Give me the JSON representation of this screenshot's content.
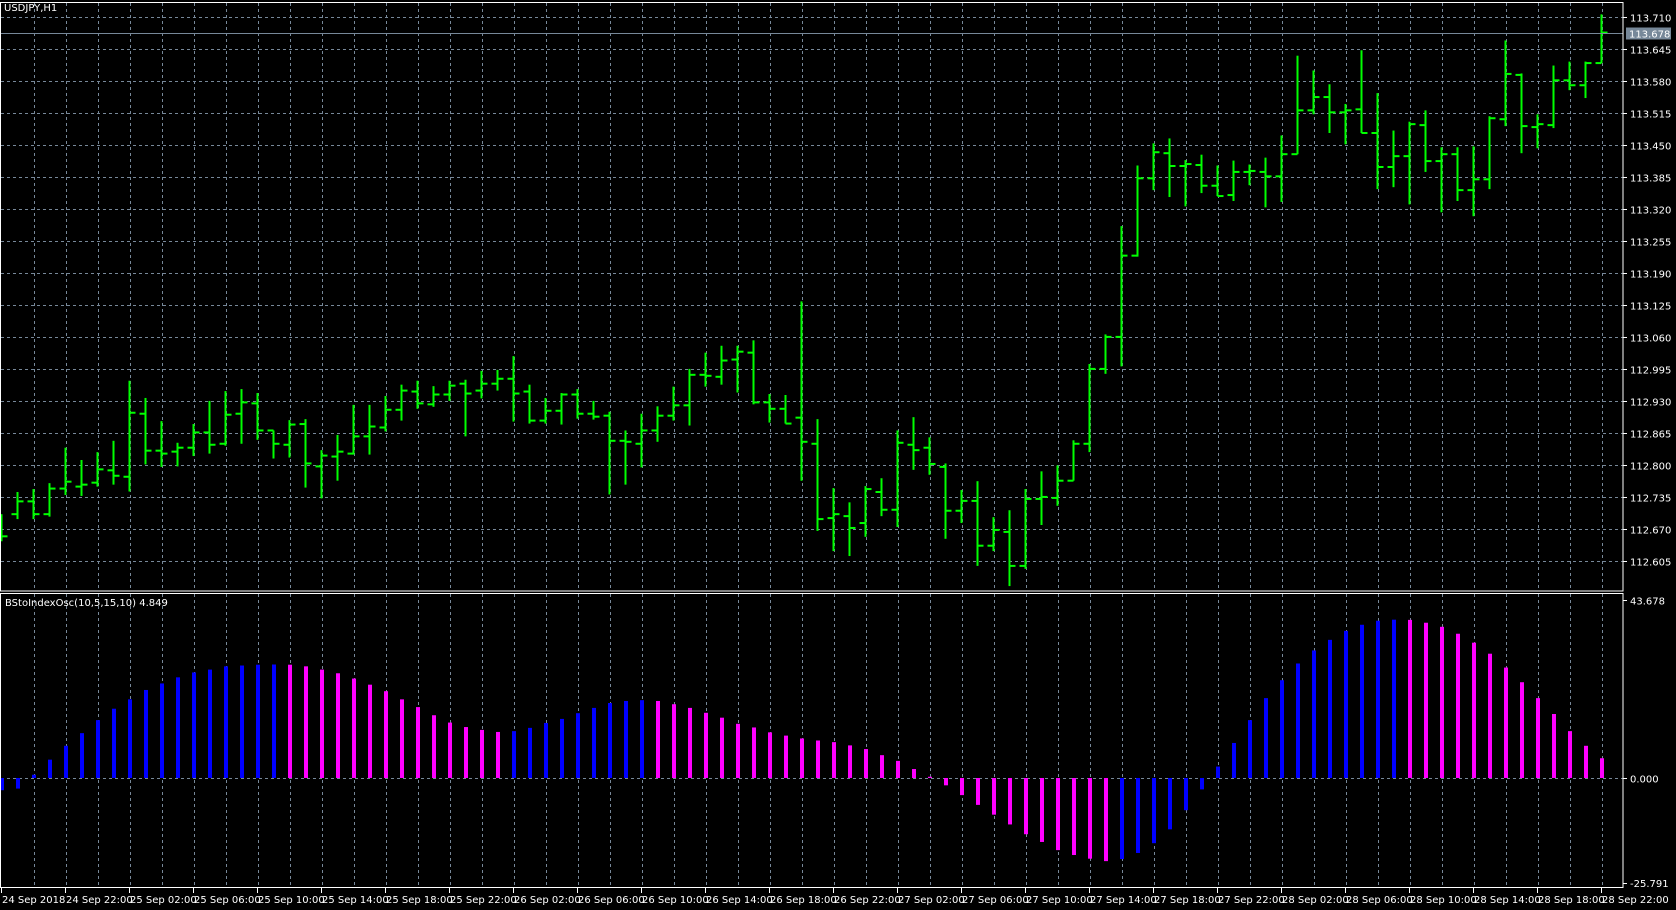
{
  "window": {
    "symbol_title": "USDJPY,H1"
  },
  "indicator": {
    "label": "BStoIndexOsc(10,5,15,10) 4.849"
  },
  "current_price": {
    "label": "113.678",
    "value": 113.678
  },
  "colors": {
    "background": "#000000",
    "grid": "#778899",
    "bars": "#00ff00",
    "up": "#0000ff",
    "down": "#ff00ff",
    "price_line": "#778899",
    "price_tag": "#778899"
  },
  "time_labels": [
    "24 Sep 2018",
    "24 Sep 22:00",
    "25 Sep 02:00",
    "25 Sep 06:00",
    "25 Sep 10:00",
    "25 Sep 14:00",
    "25 Sep 18:00",
    "25 Sep 22:00",
    "26 Sep 02:00",
    "26 Sep 06:00",
    "26 Sep 10:00",
    "26 Sep 14:00",
    "26 Sep 18:00",
    "26 Sep 22:00",
    "27 Sep 02:00",
    "27 Sep 06:00",
    "27 Sep 10:00",
    "27 Sep 14:00",
    "27 Sep 18:00",
    "27 Sep 22:00",
    "28 Sep 02:00",
    "28 Sep 06:00",
    "28 Sep 10:00",
    "28 Sep 14:00",
    "28 Sep 18:00",
    "28 Sep 22:00"
  ],
  "chart_data": [
    {
      "type": "ohlc",
      "title": "USDJPY,H1",
      "ylim": [
        112.544,
        113.738
      ],
      "y_ticks": [
        "113.710",
        "113.645",
        "113.580",
        "113.515",
        "113.450",
        "113.385",
        "113.320",
        "113.255",
        "113.190",
        "113.125",
        "113.060",
        "112.995",
        "112.930",
        "112.865",
        "112.800",
        "112.735",
        "112.670",
        "112.605"
      ],
      "grid": true,
      "ohlc": [
        [
          112.65,
          112.7,
          112.645,
          112.655
        ],
        [
          112.7,
          112.745,
          112.69,
          112.726
        ],
        [
          112.726,
          112.751,
          112.69,
          112.7
        ],
        [
          112.7,
          112.763,
          112.695,
          112.752
        ],
        [
          112.752,
          112.835,
          112.739,
          112.766
        ],
        [
          112.756,
          112.81,
          112.737,
          112.76
        ],
        [
          112.764,
          112.826,
          112.756,
          112.791
        ],
        [
          112.789,
          112.849,
          112.76,
          112.778
        ],
        [
          112.776,
          112.971,
          112.746,
          112.906
        ],
        [
          112.904,
          112.936,
          112.801,
          112.829
        ],
        [
          112.829,
          112.889,
          112.796,
          112.823
        ],
        [
          112.827,
          112.845,
          112.797,
          112.835
        ],
        [
          112.835,
          112.883,
          112.818,
          112.866
        ],
        [
          112.866,
          112.93,
          112.823,
          112.841
        ],
        [
          112.843,
          112.95,
          112.839,
          112.902
        ],
        [
          112.904,
          112.954,
          112.843,
          112.927
        ],
        [
          112.925,
          112.946,
          112.851,
          112.87
        ],
        [
          112.87,
          112.87,
          112.813,
          112.843
        ],
        [
          112.841,
          112.891,
          112.815,
          112.882
        ],
        [
          112.883,
          112.893,
          112.754,
          112.803
        ],
        [
          112.797,
          112.83,
          112.732,
          112.819
        ],
        [
          112.817,
          112.861,
          112.768,
          112.827
        ],
        [
          112.823,
          112.922,
          112.821,
          112.858
        ],
        [
          112.858,
          112.922,
          112.821,
          112.878
        ],
        [
          112.876,
          112.94,
          112.868,
          112.912
        ],
        [
          112.912,
          112.963,
          112.89,
          112.951
        ],
        [
          112.949,
          112.971,
          112.914,
          112.925
        ],
        [
          112.923,
          112.96,
          112.918,
          112.943
        ],
        [
          112.943,
          112.971,
          112.93,
          112.961
        ],
        [
          112.965,
          112.973,
          112.858,
          112.945
        ],
        [
          112.951,
          112.991,
          112.935,
          112.965
        ],
        [
          112.965,
          112.993,
          112.951,
          112.975
        ],
        [
          112.975,
          113.021,
          112.888,
          112.945
        ],
        [
          112.949,
          112.963,
          112.884,
          112.89
        ],
        [
          112.89,
          112.936,
          112.884,
          112.91
        ],
        [
          112.91,
          112.946,
          112.882,
          112.943
        ],
        [
          112.943,
          112.954,
          112.894,
          112.904
        ],
        [
          112.904,
          112.93,
          112.892,
          112.898
        ],
        [
          112.9,
          112.908,
          112.74,
          112.849
        ],
        [
          112.849,
          112.87,
          112.76,
          112.847
        ],
        [
          112.843,
          112.904,
          112.795,
          112.87
        ],
        [
          112.87,
          112.919,
          112.847,
          112.9
        ],
        [
          112.9,
          112.959,
          112.89,
          112.921
        ],
        [
          112.921,
          112.995,
          112.88,
          112.983
        ],
        [
          112.983,
          113.028,
          112.959,
          112.981
        ],
        [
          112.979,
          113.042,
          112.963,
          113.012
        ],
        [
          113.014,
          113.042,
          112.947,
          113.03
        ],
        [
          113.028,
          113.053,
          112.923,
          112.927
        ],
        [
          112.927,
          112.944,
          112.886,
          112.914
        ],
        [
          112.914,
          112.942,
          112.884,
          112.884
        ],
        [
          112.896,
          113.132,
          112.768,
          112.847
        ],
        [
          112.843,
          112.893,
          112.666,
          112.69
        ],
        [
          112.692,
          112.753,
          112.625,
          112.7
        ],
        [
          112.696,
          112.724,
          112.615,
          112.672
        ],
        [
          112.682,
          112.757,
          112.654,
          112.751
        ],
        [
          112.745,
          112.773,
          112.696,
          112.709
        ],
        [
          112.709,
          112.87,
          112.674,
          112.845
        ],
        [
          112.841,
          112.897,
          112.79,
          112.83
        ],
        [
          112.835,
          112.856,
          112.78,
          112.802
        ],
        [
          112.796,
          112.803,
          112.65,
          112.707
        ],
        [
          112.707,
          112.749,
          112.682,
          112.727
        ],
        [
          112.727,
          112.767,
          112.595,
          112.636
        ],
        [
          112.636,
          112.694,
          112.625,
          112.668
        ],
        [
          112.664,
          112.708,
          112.554,
          112.595
        ],
        [
          112.595,
          112.751,
          112.589,
          112.731
        ],
        [
          112.731,
          112.787,
          112.678,
          112.735
        ],
        [
          112.733,
          112.799,
          112.717,
          112.768
        ],
        [
          112.768,
          112.85,
          112.768,
          112.843
        ],
        [
          112.843,
          113.005,
          112.826,
          112.995
        ],
        [
          112.995,
          113.065,
          112.985,
          113.06
        ],
        [
          113.06,
          113.285,
          113.0,
          113.225
        ],
        [
          113.225,
          113.408,
          113.223,
          113.382
        ],
        [
          113.382,
          113.453,
          113.358,
          113.435
        ],
        [
          113.433,
          113.463,
          113.344,
          113.407
        ],
        [
          113.407,
          113.419,
          113.325,
          113.411
        ],
        [
          113.409,
          113.43,
          113.352,
          113.367
        ],
        [
          113.367,
          113.408,
          113.346,
          113.346
        ],
        [
          113.348,
          113.418,
          113.336,
          113.395
        ],
        [
          113.395,
          113.41,
          113.368,
          113.397
        ],
        [
          113.395,
          113.424,
          113.323,
          113.386
        ],
        [
          113.386,
          113.469,
          113.334,
          113.431
        ],
        [
          113.431,
          113.631,
          113.431,
          113.52
        ],
        [
          113.52,
          113.601,
          113.512,
          113.547
        ],
        [
          113.547,
          113.573,
          113.474,
          113.516
        ],
        [
          113.516,
          113.533,
          113.451,
          113.52
        ],
        [
          113.522,
          113.642,
          113.474,
          113.474
        ],
        [
          113.474,
          113.555,
          113.36,
          113.405
        ],
        [
          113.405,
          113.479,
          113.364,
          113.427
        ],
        [
          113.427,
          113.497,
          113.329,
          113.492
        ],
        [
          113.49,
          113.52,
          113.395,
          113.417
        ],
        [
          113.417,
          113.445,
          113.313,
          113.431
        ],
        [
          113.431,
          113.445,
          113.336,
          113.358
        ],
        [
          113.358,
          113.447,
          113.305,
          113.38
        ],
        [
          113.38,
          113.508,
          113.36,
          113.504
        ],
        [
          113.502,
          113.662,
          113.488,
          113.594
        ],
        [
          113.592,
          113.595,
          113.433,
          113.488
        ],
        [
          113.486,
          113.512,
          113.443,
          113.492
        ],
        [
          113.49,
          113.611,
          113.484,
          113.581
        ],
        [
          113.581,
          113.619,
          113.561,
          113.571
        ],
        [
          113.571,
          113.619,
          113.545,
          113.616
        ],
        [
          113.616,
          113.715,
          113.616,
          113.678
        ]
      ]
    },
    {
      "type": "bar",
      "title": "BStoIndexOsc(10,5,15,10)",
      "ylim": [
        -26.75,
        45.15
      ],
      "y_ticks": [
        "43.678",
        "0.000",
        "-25.791"
      ],
      "y_tick_values": [
        43.678,
        0,
        -25.791
      ],
      "values": [
        -3.0,
        -2.6,
        0.8,
        4.5,
        7.9,
        11.0,
        14.2,
        17.0,
        19.3,
        21.6,
        23.2,
        24.7,
        25.9,
        26.6,
        27.4,
        27.6,
        27.8,
        27.85,
        27.8,
        27.4,
        26.6,
        25.7,
        24.4,
        22.9,
        21.3,
        19.3,
        17.4,
        15.4,
        13.6,
        12.5,
        11.8,
        11.3,
        11.5,
        12.3,
        13.5,
        14.5,
        15.9,
        17.2,
        18.4,
        18.9,
        19.1,
        18.9,
        18.1,
        17.2,
        16.0,
        14.8,
        13.3,
        12.4,
        11.2,
        10.4,
        9.7,
        9.2,
        8.8,
        8.0,
        7.1,
        5.6,
        4.2,
        2.2,
        0.3,
        -1.8,
        -4.2,
        -6.6,
        -9.0,
        -11.4,
        -13.8,
        -15.7,
        -17.7,
        -18.9,
        -19.8,
        -20.4,
        -19.9,
        -18.4,
        -16.0,
        -12.6,
        -7.9,
        -2.8,
        2.8,
        8.6,
        14.2,
        19.6,
        24.0,
        28.1,
        31.3,
        33.9,
        36.1,
        37.6,
        38.6,
        38.85,
        38.8,
        38.1,
        37.1,
        35.4,
        33.2,
        30.5,
        27.1,
        23.5,
        19.6,
        15.7,
        11.5,
        7.9,
        4.849
      ]
    }
  ]
}
